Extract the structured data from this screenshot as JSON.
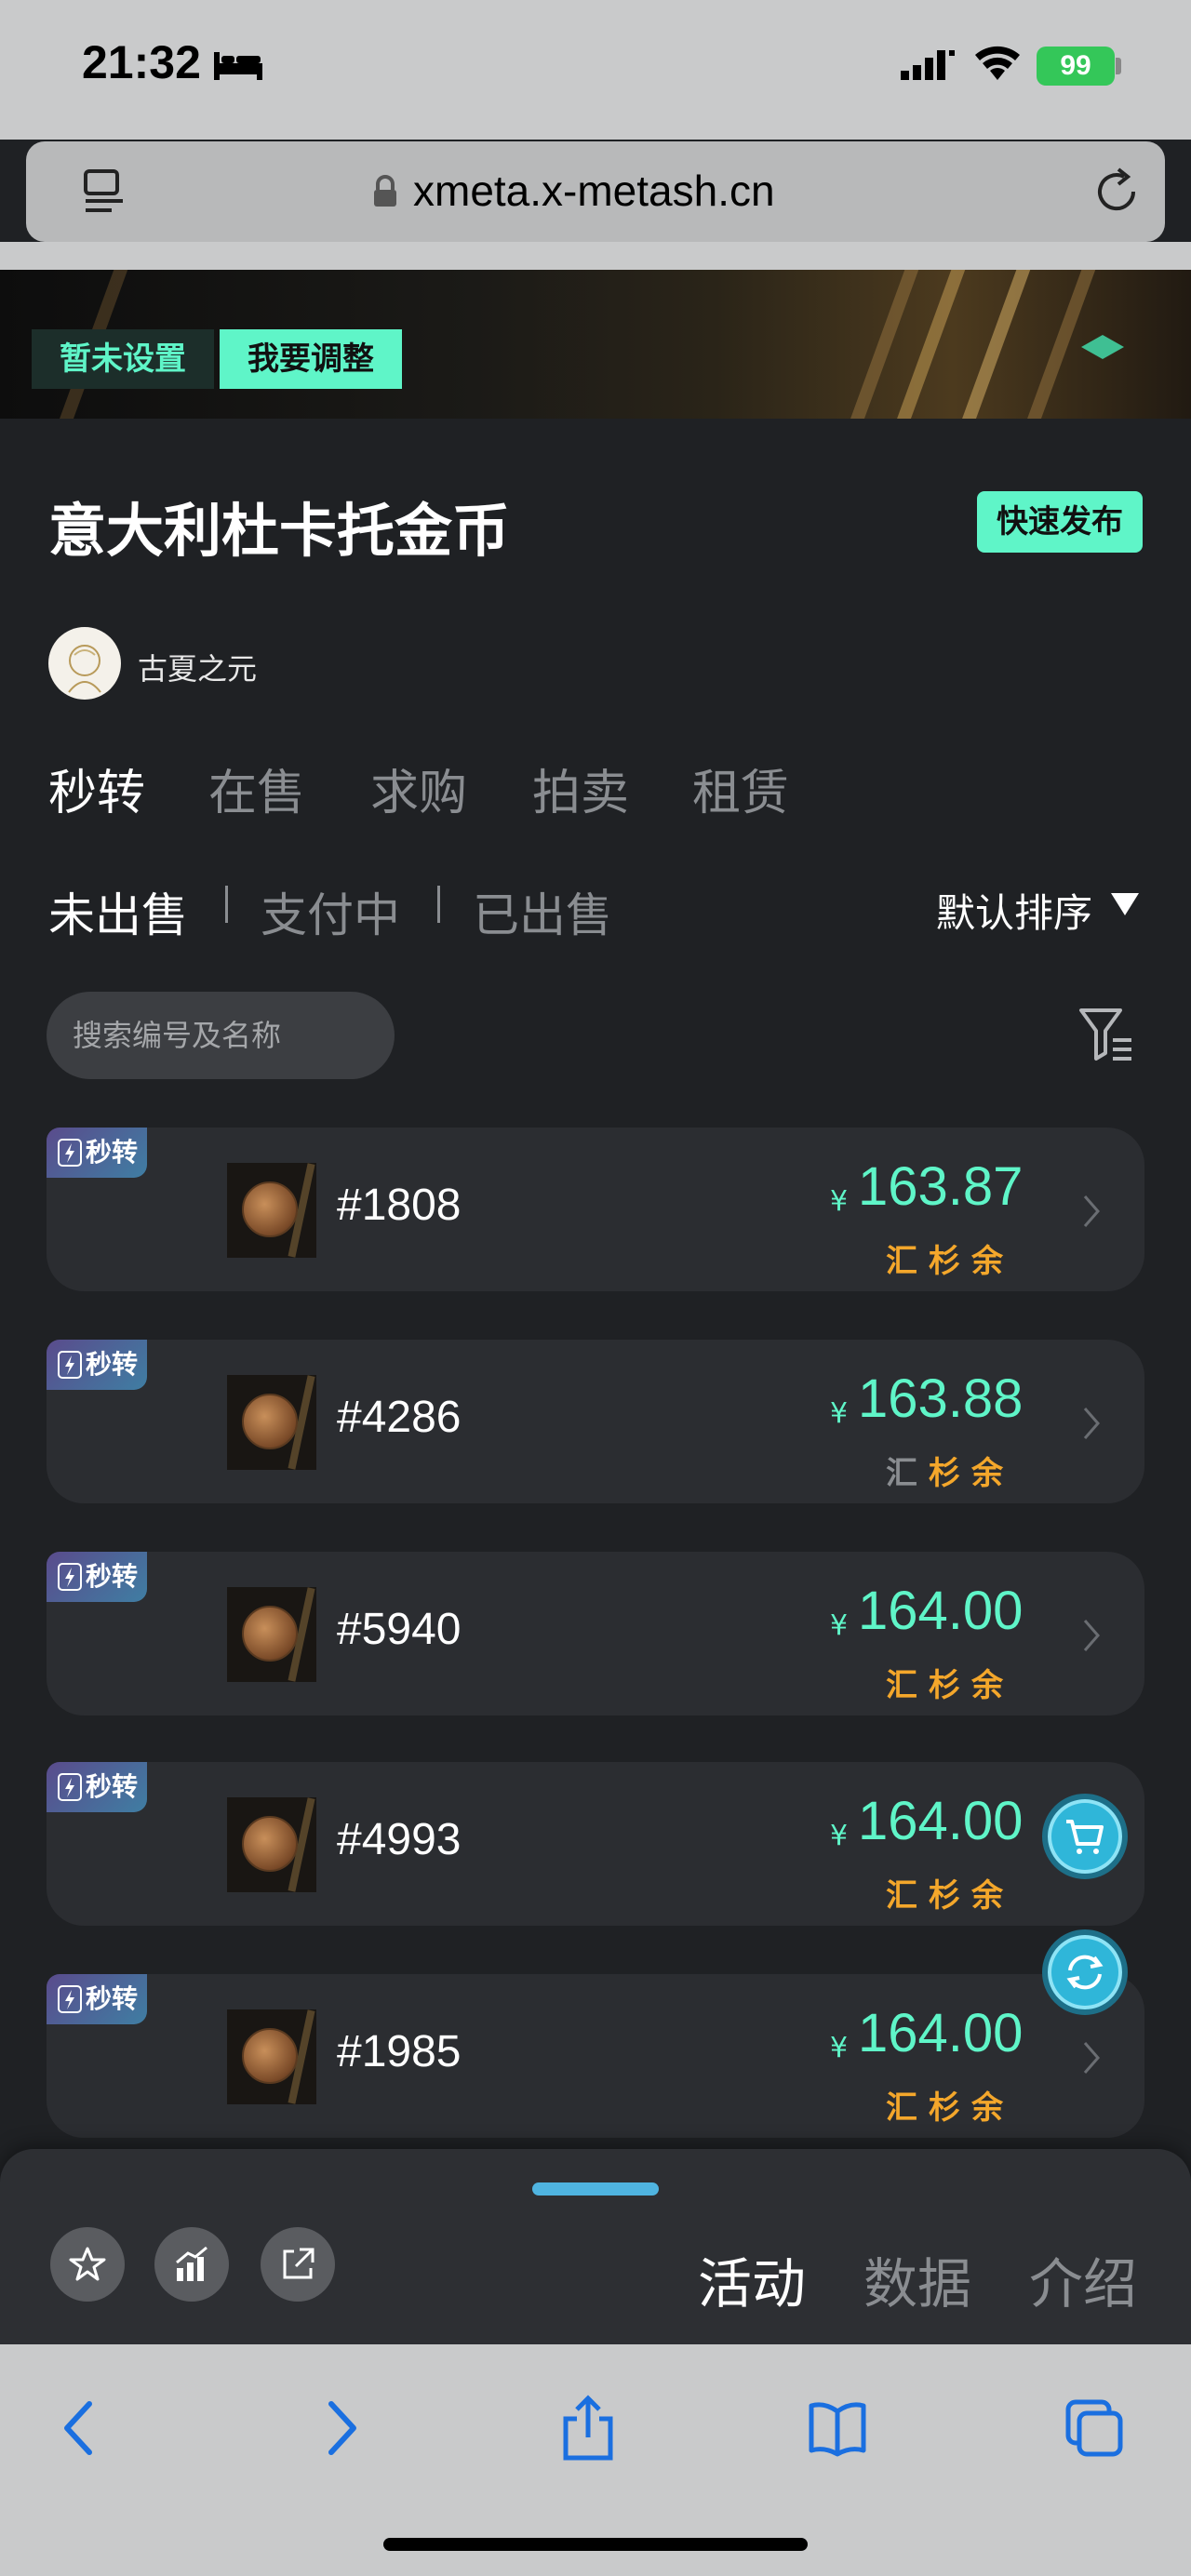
{
  "status": {
    "time": "21:32",
    "battery": "99"
  },
  "browser": {
    "url": "xmeta.x-metash.cn"
  },
  "banner": {
    "tag_unset": "暂未设置",
    "tag_adjust": "我要调整"
  },
  "header": {
    "title": "意大利杜卡托金币",
    "quick_publish": "快速发布",
    "author": "古夏之元"
  },
  "tabs": [
    "秒转",
    "在售",
    "求购",
    "拍卖",
    "租赁"
  ],
  "subtabs": [
    "未出售",
    "支付中",
    "已出售"
  ],
  "sort_label": "默认排序",
  "search_placeholder": "搜索编号及名称",
  "badge_label": "秒转",
  "currency": "¥",
  "payment_chars": [
    "汇",
    "杉",
    "余"
  ],
  "items": [
    {
      "id": "#1808",
      "price": "163.87",
      "pay_active": [
        true,
        true,
        true
      ]
    },
    {
      "id": "#4286",
      "price": "163.88",
      "pay_active": [
        false,
        true,
        true
      ]
    },
    {
      "id": "#5940",
      "price": "164.00",
      "pay_active": [
        true,
        true,
        true
      ]
    },
    {
      "id": "#4993",
      "price": "164.00",
      "pay_active": [
        true,
        true,
        true
      ]
    },
    {
      "id": "#1985",
      "price": "164.00",
      "pay_active": [
        true,
        true,
        true
      ]
    }
  ],
  "sheet_tabs": [
    "活动",
    "数据",
    "介绍"
  ],
  "colors": {
    "accent": "#5ff5c8",
    "payment": "#f4a72b",
    "float_button": "#2fb6d9"
  },
  "icons": {
    "sheet_buttons": [
      "star-icon",
      "chart-icon",
      "share-out-icon"
    ],
    "toolbar": [
      "back-icon",
      "forward-icon",
      "share-icon",
      "bookmarks-icon",
      "tabs-icon"
    ],
    "floating": [
      "cart-icon",
      "refresh-icon"
    ]
  }
}
